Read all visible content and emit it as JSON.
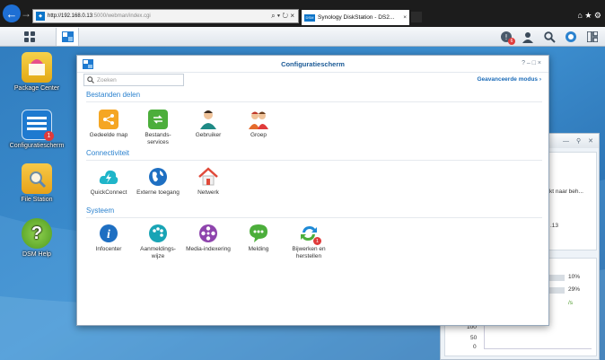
{
  "browser": {
    "url_host": "http://192.168.0.13",
    "url_path": ":5000/webman/index.cgi",
    "addr_tools": "⌕ ▾ ↻ ×",
    "tab_title": "Synology DiskStation - DS2...",
    "tab_close": "×",
    "right_icons": "⌂ ★ ⚙"
  },
  "taskbar": {
    "notification_count": "6"
  },
  "desktop": {
    "icons": [
      {
        "label": "Package Center"
      },
      {
        "label": "Configuratiescherm",
        "badge": "1"
      },
      {
        "label": "File Station"
      },
      {
        "label": "DSM Help"
      }
    ]
  },
  "widget": {
    "text1": "kt naar beh...",
    "text2": ".13",
    "pct1": "10%",
    "pct2": "29%",
    "speed": "/s",
    "axis": [
      "100",
      "50",
      "0"
    ]
  },
  "window": {
    "title": "Configuratiescherm",
    "controls": "? – □ ×",
    "search_placeholder": "Zoeken",
    "advanced_mode": "Geavanceerde modus ›",
    "sections": [
      {
        "title": "Bestanden delen",
        "items": [
          {
            "label": "Gedeelde map"
          },
          {
            "label": "Bestands-services"
          },
          {
            "label": "Gebruiker"
          },
          {
            "label": "Groep"
          }
        ]
      },
      {
        "title": "Connectiviteit",
        "items": [
          {
            "label": "QuickConnect"
          },
          {
            "label": "Externe toegang"
          },
          {
            "label": "Netwerk"
          }
        ]
      },
      {
        "title": "Systeem",
        "items": [
          {
            "label": "Infocenter"
          },
          {
            "label": "Aanmeldings-wijze"
          },
          {
            "label": "Media-indexering"
          },
          {
            "label": "Melding"
          },
          {
            "label": "Bijwerken en herstellen",
            "badge": "1"
          }
        ]
      }
    ]
  },
  "colors": {
    "accent": "#2b82cf",
    "title": "#1b5a96",
    "badge": "#e03b3b"
  }
}
